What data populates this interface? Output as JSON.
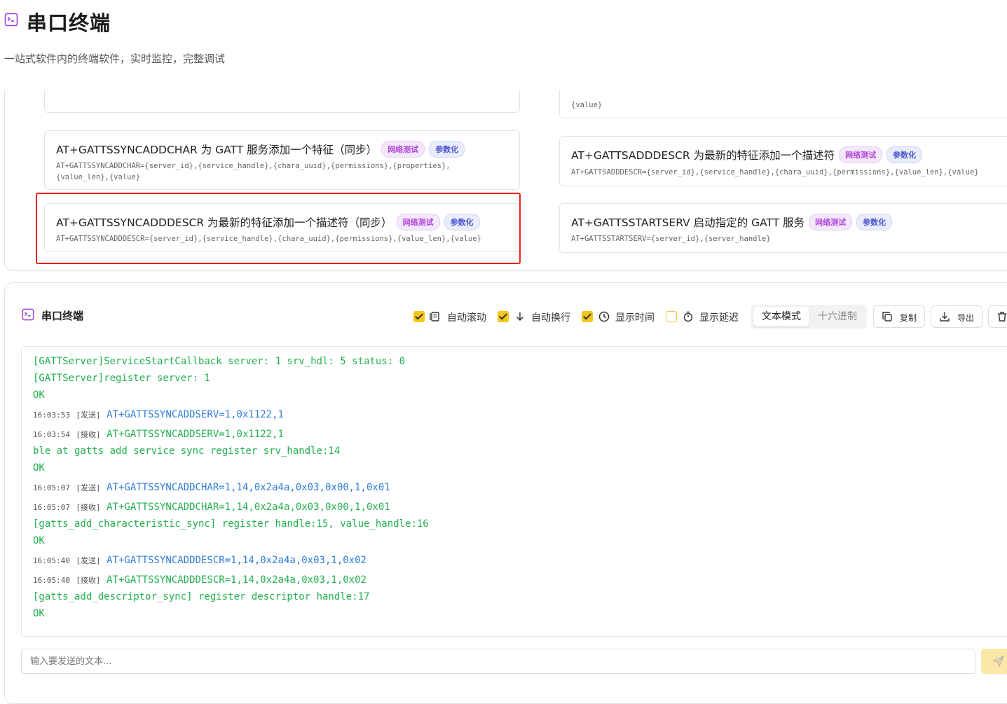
{
  "header": {
    "title": "串口终端",
    "subtitle": "一站式软件内的终端软件，实时监控，完整调试"
  },
  "commands": {
    "cards": [
      {
        "title": "AT+GATTSSYNCADDCHAR 为 GATT 服务添加一个特征（同步）",
        "tags": [
          "网络测试",
          "参数化"
        ],
        "syntax_line1": "AT+GATTSSYNCADDCHAR={server_id},{service_handle},{chara_uuid},{permissions},{properties},",
        "syntax_line2": "{value_len},{value}"
      },
      {
        "title": "AT+GATTSSYNCADDDESCR 为最新的特征添加一个描述符（同步）",
        "tags": [
          "网络测试",
          "参数化"
        ],
        "syntax_line1": "AT+GATTSSYNCADDDESCR={server_id},{service_handle},{chara_uuid},{permissions},{value_len},{value}"
      },
      {
        "syntax_line1": "{value}"
      },
      {
        "title": "AT+GATTSADDDESCR 为最新的特征添加一个描述符",
        "tags": [
          "网络测试",
          "参数化"
        ],
        "syntax_line1": "AT+GATTSADDDESCR={server_id},{service_handle},{chara_uuid},{permissions},{value_len},{value}"
      },
      {
        "title": "AT+GATTSSTARTSERV 启动指定的 GATT 服务",
        "tags": [
          "网络测试",
          "参数化"
        ],
        "syntax_line1": "AT+GATTSSTARTSERV={server_id},{server_handle}"
      }
    ]
  },
  "terminal": {
    "title": "串口终端",
    "options": {
      "auto_scroll": {
        "label": "自动滚动",
        "checked": true
      },
      "auto_wrap": {
        "label": "自动换行",
        "checked": true
      },
      "show_time": {
        "label": "显示时间",
        "checked": true
      },
      "show_delay": {
        "label": "显示延迟",
        "checked": false
      }
    },
    "modes": {
      "text": "文本模式",
      "hex": "十六进制",
      "selected": "文本模式"
    },
    "buttons": {
      "copy": "复制",
      "export": "导出"
    },
    "lines": [
      {
        "kind": "plain",
        "text": "[GATTServer]ServiceStartCallback server: 1 srv_hdl: 5 status: 0"
      },
      {
        "kind": "plain",
        "text": "[GATTServer]register server: 1"
      },
      {
        "kind": "plain",
        "text": "OK"
      },
      {
        "kind": "send",
        "time": "16:03:53",
        "dir": "[发送]",
        "text": "AT+GATTSSYNCADDSERV=1,0x1122,1"
      },
      {
        "kind": "recv",
        "time": "16:03:54",
        "dir": "[接收]",
        "text": "AT+GATTSSYNCADDSERV=1,0x1122,1"
      },
      {
        "kind": "plain",
        "text": "ble at gatts add service sync register srv_handle:14"
      },
      {
        "kind": "plain",
        "text": "OK"
      },
      {
        "kind": "send",
        "time": "16:05:07",
        "dir": "[发送]",
        "text": "AT+GATTSSYNCADDCHAR=1,14,0x2a4a,0x03,0x00,1,0x01"
      },
      {
        "kind": "recv",
        "time": "16:05:07",
        "dir": "[接收]",
        "text": "AT+GATTSSYNCADDCHAR=1,14,0x2a4a,0x03,0x00,1,0x01"
      },
      {
        "kind": "plain",
        "text": "[gatts_add_characteristic_sync] register handle:15, value_handle:16"
      },
      {
        "kind": "plain",
        "text": "OK"
      },
      {
        "kind": "send",
        "time": "16:05:40",
        "dir": "[发送]",
        "text": "AT+GATTSSYNCADDDESCR=1,14,0x2a4a,0x03,1,0x02"
      },
      {
        "kind": "recv",
        "time": "16:05:40",
        "dir": "[接收]",
        "text": "AT+GATTSSYNCADDDESCR=1,14,0x2a4a,0x03,1,0x02"
      },
      {
        "kind": "plain",
        "text": "[gatts_add_descriptor_sync] register descriptor handle:17"
      },
      {
        "kind": "plain",
        "text": "OK"
      }
    ],
    "input": {
      "placeholder": "输入要发送的文本...",
      "value": ""
    }
  },
  "colors": {
    "accent": "#f5c518",
    "send_text": "#2f7ddb",
    "recv_text": "#22b04f",
    "highlight_box": "#e8211b",
    "tag_network": "#b146d8",
    "tag_param": "#4a55cf"
  }
}
